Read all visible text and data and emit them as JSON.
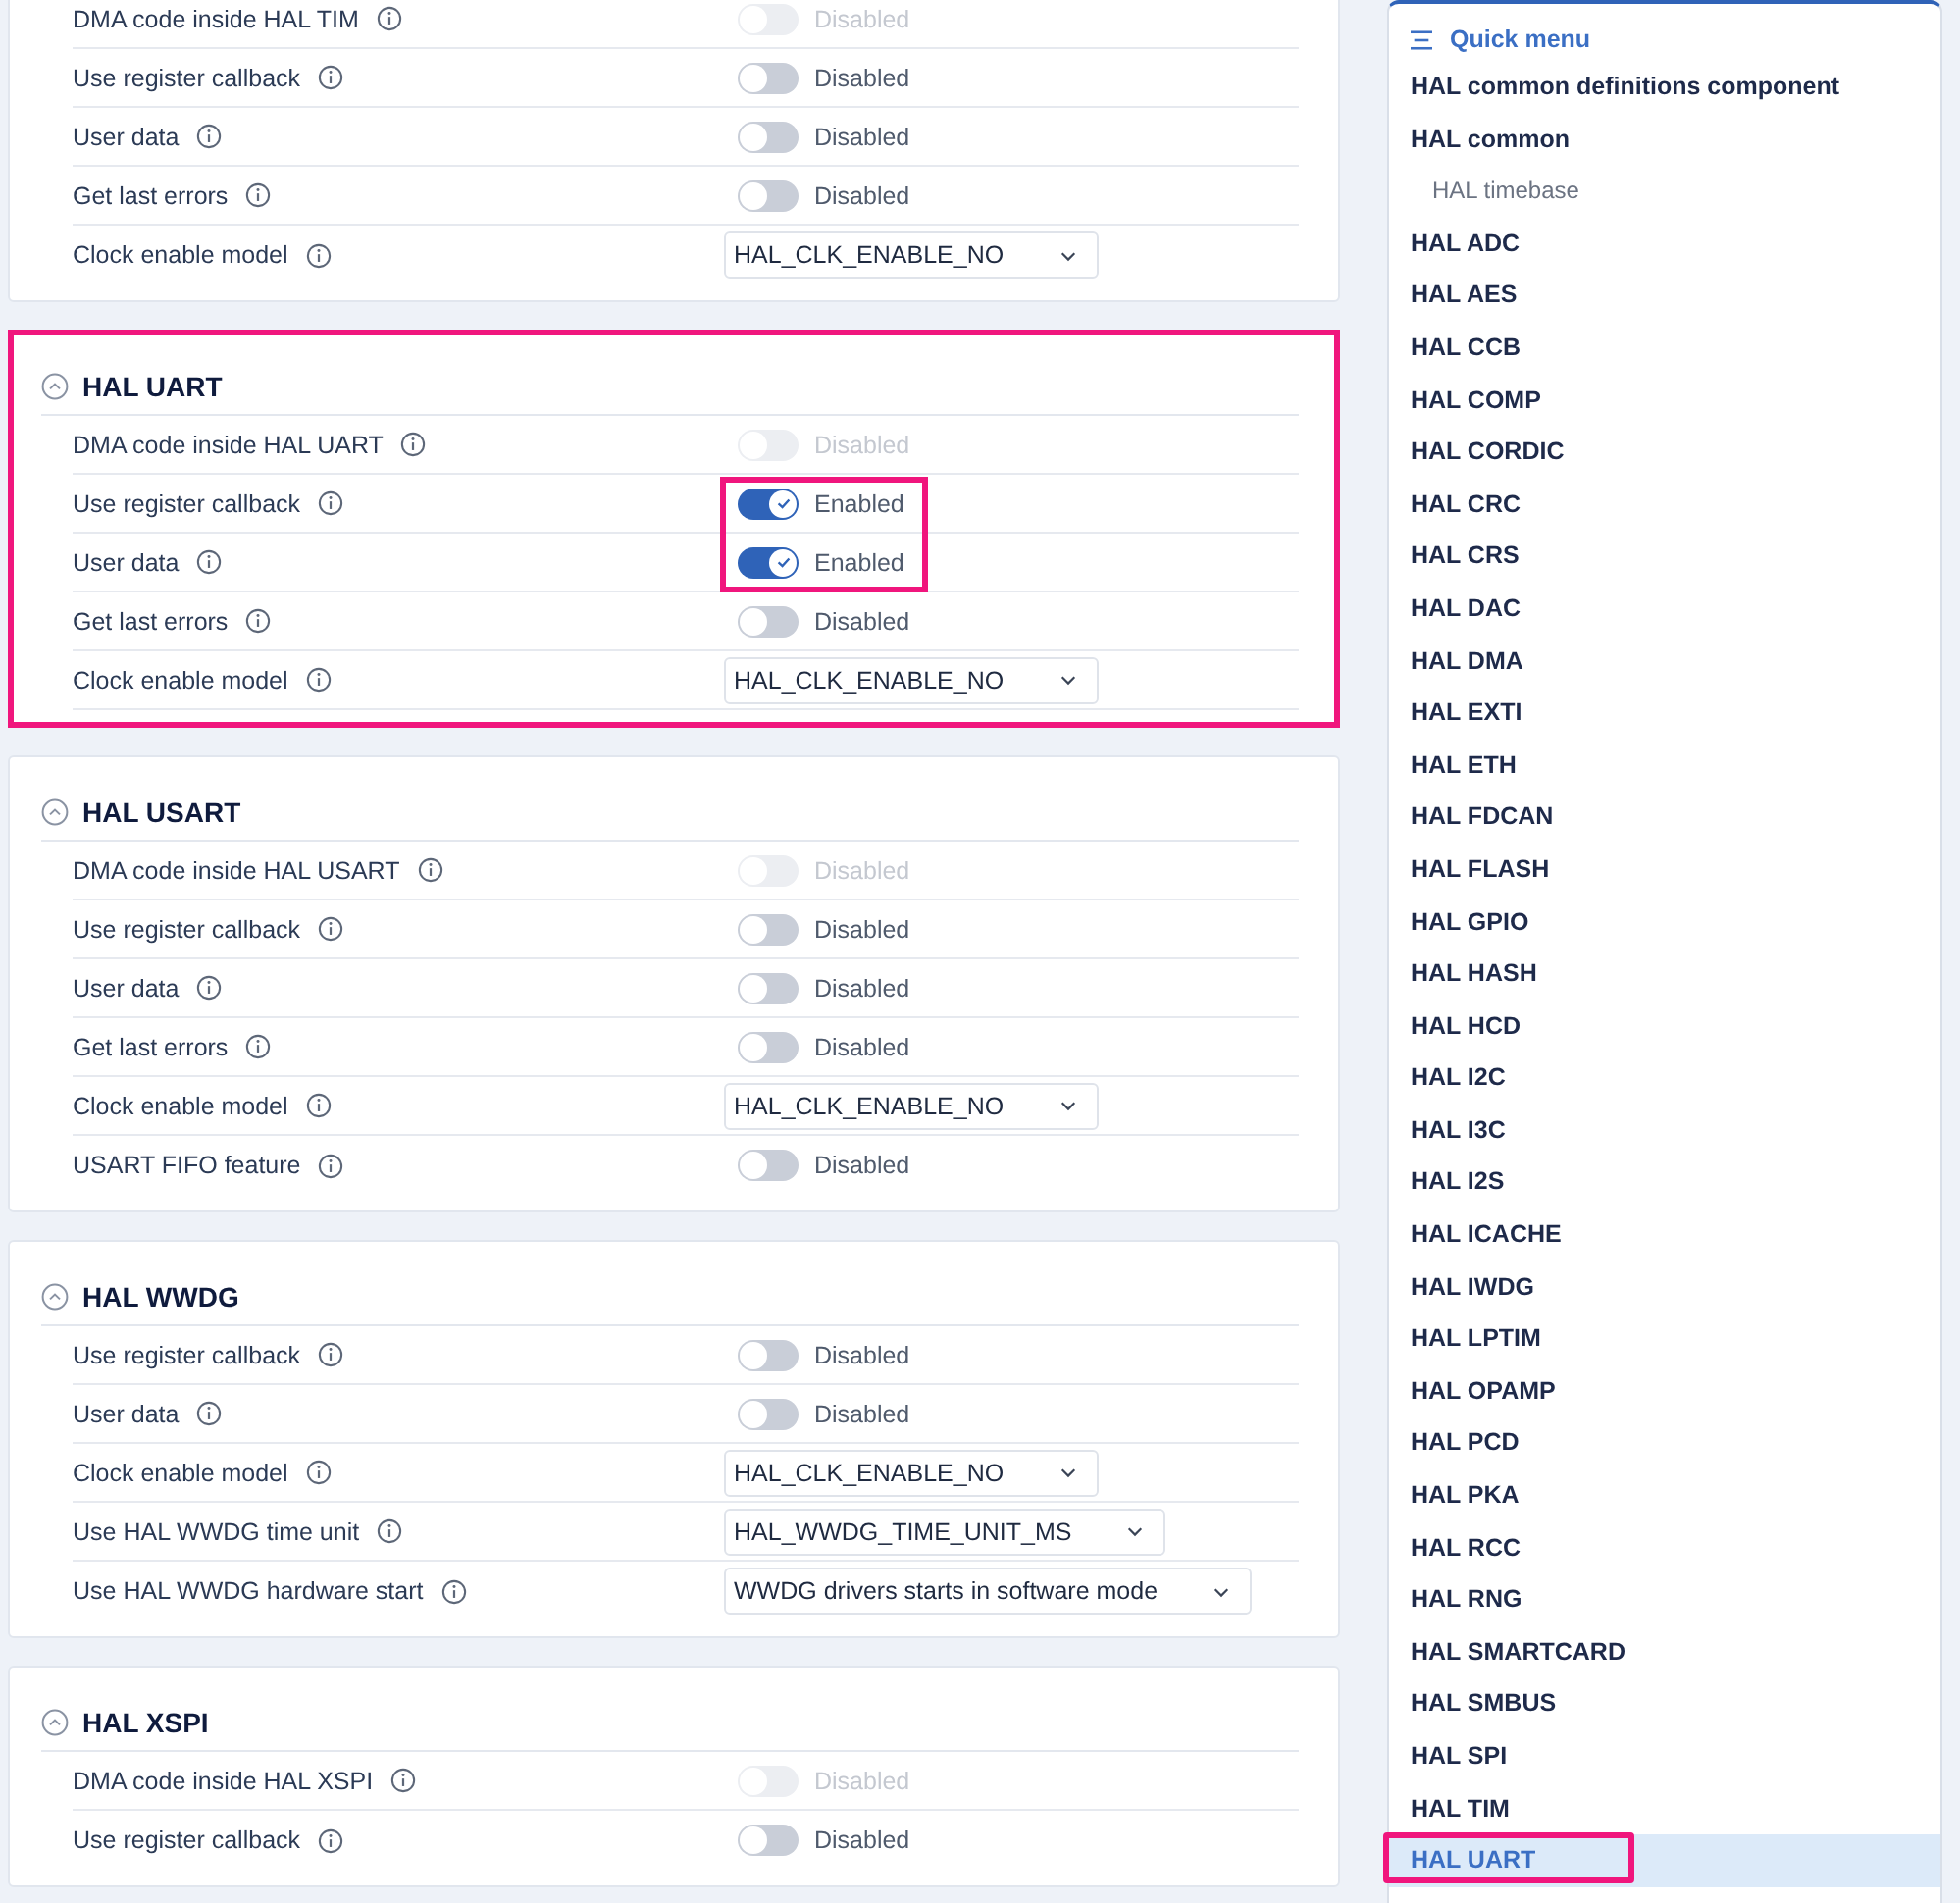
{
  "sections": [
    {
      "highlighted": false,
      "rows": [
        {
          "kind": "toggle",
          "label": "DMA code inside HAL TIM",
          "on": false,
          "disabled": true,
          "value": "Disabled"
        },
        {
          "kind": "toggle",
          "label": "Use register callback",
          "on": false,
          "disabled": false,
          "value": "Disabled"
        },
        {
          "kind": "toggle",
          "label": "User data",
          "on": false,
          "disabled": false,
          "value": "Disabled"
        },
        {
          "kind": "toggle",
          "label": "Get last errors",
          "on": false,
          "disabled": false,
          "value": "Disabled"
        },
        {
          "kind": "select",
          "label": "Clock enable model",
          "value": "HAL_CLK_ENABLE_NO"
        }
      ]
    },
    {
      "title": "HAL UART",
      "highlighted": true,
      "rows": [
        {
          "kind": "toggle",
          "label": "DMA code inside HAL UART",
          "on": false,
          "disabled": true,
          "value": "Disabled",
          "highlighted": false
        },
        {
          "kind": "toggle",
          "label": "Use register callback",
          "on": true,
          "disabled": false,
          "value": "Enabled",
          "highlighted": true
        },
        {
          "kind": "toggle",
          "label": "User data",
          "on": true,
          "disabled": false,
          "value": "Enabled",
          "highlighted": true
        },
        {
          "kind": "toggle",
          "label": "Get last errors",
          "on": false,
          "disabled": false,
          "value": "Disabled",
          "highlighted": false
        },
        {
          "kind": "select",
          "label": "Clock enable model",
          "value": "HAL_CLK_ENABLE_NO",
          "highlighted": false
        }
      ]
    },
    {
      "title": "HAL USART",
      "highlighted": false,
      "rows": [
        {
          "kind": "toggle",
          "label": "DMA code inside HAL USART",
          "on": false,
          "disabled": true,
          "value": "Disabled"
        },
        {
          "kind": "toggle",
          "label": "Use register callback",
          "on": false,
          "disabled": false,
          "value": "Disabled"
        },
        {
          "kind": "toggle",
          "label": "User data",
          "on": false,
          "disabled": false,
          "value": "Disabled"
        },
        {
          "kind": "toggle",
          "label": "Get last errors",
          "on": false,
          "disabled": false,
          "value": "Disabled"
        },
        {
          "kind": "select",
          "label": "Clock enable model",
          "value": "HAL_CLK_ENABLE_NO"
        },
        {
          "kind": "toggle",
          "label": "USART FIFO feature",
          "on": false,
          "disabled": false,
          "value": "Disabled"
        }
      ]
    },
    {
      "title": "HAL WWDG",
      "highlighted": false,
      "rows": [
        {
          "kind": "toggle",
          "label": "Use register callback",
          "on": false,
          "disabled": false,
          "value": "Disabled"
        },
        {
          "kind": "toggle",
          "label": "User data",
          "on": false,
          "disabled": false,
          "value": "Disabled"
        },
        {
          "kind": "select",
          "label": "Clock enable model",
          "value": "HAL_CLK_ENABLE_NO"
        },
        {
          "kind": "select",
          "label": "Use HAL WWDG time unit",
          "value": "HAL_WWDG_TIME_UNIT_MS"
        },
        {
          "kind": "select",
          "label": "Use HAL WWDG hardware start",
          "value": "WWDG drivers starts in software mode"
        }
      ]
    },
    {
      "title": "HAL XSPI",
      "highlighted": false,
      "rows": [
        {
          "kind": "toggle",
          "label": "DMA code inside HAL XSPI",
          "on": false,
          "disabled": true,
          "value": "Disabled"
        },
        {
          "kind": "toggle",
          "label": "Use register callback",
          "on": false,
          "disabled": false,
          "value": "Disabled"
        }
      ]
    }
  ],
  "quick_menu": {
    "title": "Quick menu",
    "items": [
      {
        "label": "HAL common definitions component",
        "selected": false,
        "highlighted": false
      },
      {
        "label": "HAL common",
        "selected": false,
        "highlighted": false,
        "children": [
          {
            "label": "HAL timebase",
            "selected": false,
            "highlighted": false
          }
        ]
      },
      {
        "label": "HAL ADC",
        "selected": false,
        "highlighted": false
      },
      {
        "label": "HAL AES",
        "selected": false,
        "highlighted": false
      },
      {
        "label": "HAL CCB",
        "selected": false,
        "highlighted": false
      },
      {
        "label": "HAL COMP",
        "selected": false,
        "highlighted": false
      },
      {
        "label": "HAL CORDIC",
        "selected": false,
        "highlighted": false
      },
      {
        "label": "HAL CRC",
        "selected": false,
        "highlighted": false
      },
      {
        "label": "HAL CRS",
        "selected": false,
        "highlighted": false
      },
      {
        "label": "HAL DAC",
        "selected": false,
        "highlighted": false
      },
      {
        "label": "HAL DMA",
        "selected": false,
        "highlighted": false
      },
      {
        "label": "HAL EXTI",
        "selected": false,
        "highlighted": false
      },
      {
        "label": "HAL ETH",
        "selected": false,
        "highlighted": false
      },
      {
        "label": "HAL FDCAN",
        "selected": false,
        "highlighted": false
      },
      {
        "label": "HAL FLASH",
        "selected": false,
        "highlighted": false
      },
      {
        "label": "HAL GPIO",
        "selected": false,
        "highlighted": false
      },
      {
        "label": "HAL HASH",
        "selected": false,
        "highlighted": false
      },
      {
        "label": "HAL HCD",
        "selected": false,
        "highlighted": false
      },
      {
        "label": "HAL I2C",
        "selected": false,
        "highlighted": false
      },
      {
        "label": "HAL I3C",
        "selected": false,
        "highlighted": false
      },
      {
        "label": "HAL I2S",
        "selected": false,
        "highlighted": false
      },
      {
        "label": "HAL ICACHE",
        "selected": false,
        "highlighted": false
      },
      {
        "label": "HAL IWDG",
        "selected": false,
        "highlighted": false
      },
      {
        "label": "HAL LPTIM",
        "selected": false,
        "highlighted": false
      },
      {
        "label": "HAL OPAMP",
        "selected": false,
        "highlighted": false
      },
      {
        "label": "HAL PCD",
        "selected": false,
        "highlighted": false
      },
      {
        "label": "HAL PKA",
        "selected": false,
        "highlighted": false
      },
      {
        "label": "HAL RCC",
        "selected": false,
        "highlighted": false
      },
      {
        "label": "HAL RNG",
        "selected": false,
        "highlighted": false
      },
      {
        "label": "HAL SMARTCARD",
        "selected": false,
        "highlighted": false
      },
      {
        "label": "HAL SMBUS",
        "selected": false,
        "highlighted": false
      },
      {
        "label": "HAL SPI",
        "selected": false,
        "highlighted": false
      },
      {
        "label": "HAL TIM",
        "selected": false,
        "highlighted": false
      },
      {
        "label": "HAL UART",
        "selected": true,
        "highlighted": true
      }
    ]
  }
}
